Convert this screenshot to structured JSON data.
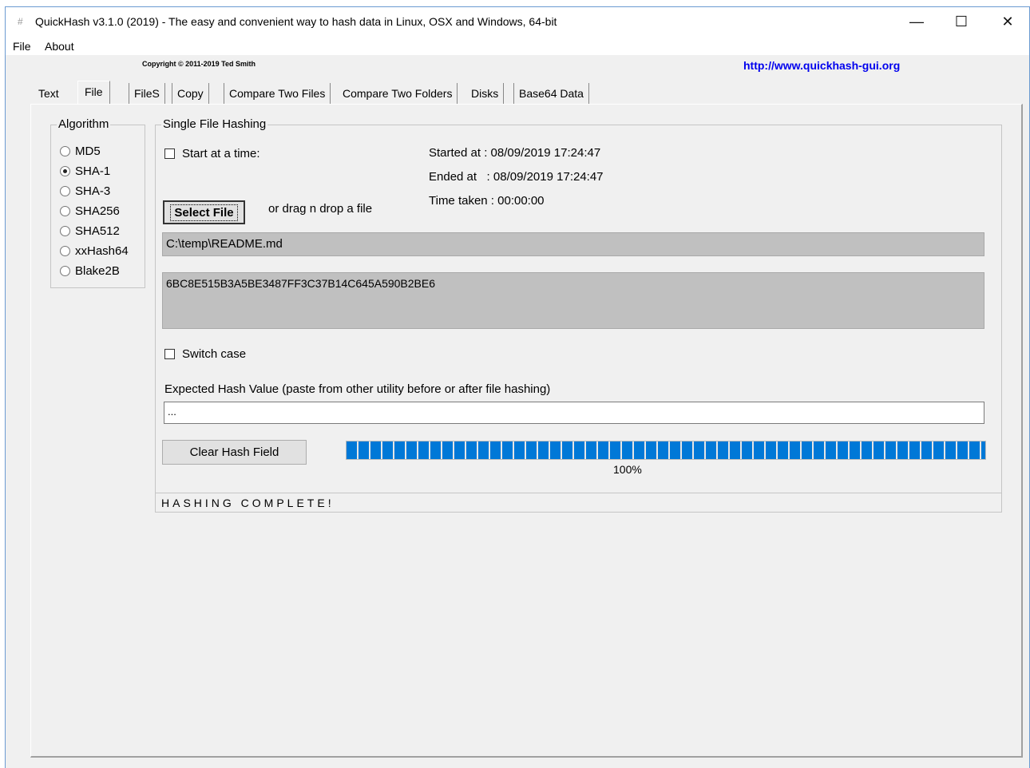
{
  "window": {
    "icon": "#",
    "title": "QuickHash v3.1.0 (2019) - The easy and convenient way to hash data in Linux, OSX and Windows, 64-bit",
    "minimize_glyph": "—",
    "maximize_glyph": "☐",
    "close_glyph": "✕"
  },
  "menu": {
    "file": "File",
    "about": "About"
  },
  "header": {
    "copyright": "Copyright © 2011-2019  Ted Smith",
    "url": "http://www.quickhash-gui.org"
  },
  "tabs": [
    "Text",
    "File",
    "FileS",
    "Copy",
    "Compare Two Files",
    "Compare Two Folders",
    "Disks",
    "Base64 Data"
  ],
  "active_tab": "File",
  "algorithm": {
    "legend": "Algorithm",
    "options": [
      "MD5",
      "SHA-1",
      "SHA-3",
      "SHA256",
      "SHA512",
      "xxHash64",
      "Blake2B"
    ],
    "selected": "SHA-1"
  },
  "single_file": {
    "legend": "Single File Hashing",
    "start_at_time_label": "Start at a time:",
    "start_at_time_checked": false,
    "started_at": "Started at : 08/09/2019 17:24:47",
    "ended_at": "Ended at   : 08/09/2019 17:24:47",
    "time_taken": "Time taken : 00:00:00",
    "select_file_label": "Select File",
    "drag_drop_text": "or drag n drop a file",
    "file_path": "C:\\temp\\README.md",
    "hash_value": "6BC8E515B3A5BE3487FF3C37B14C645A590B2BE6",
    "switch_case_label": "Switch case",
    "switch_case_checked": false,
    "expected_hash_label": "Expected Hash Value (paste from other utility before or after file hashing)",
    "expected_hash_value": "...",
    "clear_hash_label": "Clear Hash Field",
    "progress_percent": 100,
    "progress_text": "100%",
    "status": "HASHING COMPLETE!"
  },
  "colors": {
    "accent": "#0078d7",
    "link": "#0000ee",
    "panel_bg": "#f0f0f0",
    "field_gray": "#c0c0c0"
  }
}
